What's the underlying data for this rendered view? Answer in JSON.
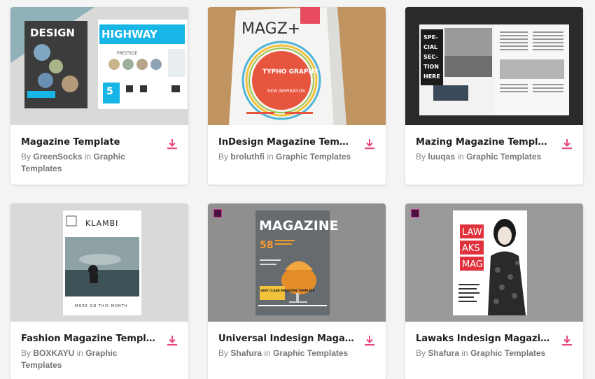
{
  "cards": [
    {
      "title": "Magazine Template",
      "by": "By",
      "author": "GreenSocks",
      "in": "in",
      "category": "Graphic Templates",
      "cover_text": [
        "DESIGN",
        "HIGHWAY",
        "PRESTIGE",
        "5"
      ]
    },
    {
      "title": "InDesign Magazine Templ...",
      "by": "By",
      "author": "broluthfi",
      "in": "in",
      "category": "Graphic Templates",
      "cover_text": [
        "MAGZ+",
        "TYPHO GRAPHY",
        "NEW INSPIRATION"
      ]
    },
    {
      "title": "Mazing Magazine Template",
      "by": "By",
      "author": "luuqas",
      "in": "in",
      "category": "Graphic Templates",
      "cover_text": [
        "SPE-",
        "CIAL",
        "SEC-",
        "TION",
        "HERE"
      ]
    },
    {
      "title": "Fashion Magazine Templa...",
      "by": "By",
      "author": "BOXKAYU",
      "in": "in",
      "category": "Graphic Templates",
      "cover_text": [
        "KLAMBI",
        "MORE ON THIS MONTH"
      ]
    },
    {
      "title": "Universal Indesign Magaz...",
      "by": "By",
      "author": "Shafura",
      "in": "in",
      "category": "Graphic Templates",
      "cover_text": [
        "MAGAZINE",
        "58",
        "VERY CLEAN MAGAZINE TEMPLATE"
      ]
    },
    {
      "title": "Lawaks Indesign Magazin...",
      "by": "By",
      "author": "Shafura",
      "in": "in",
      "category": "Graphic Templates",
      "cover_text": [
        "LAW",
        "AKS",
        "MAG"
      ]
    }
  ],
  "icons": {
    "download": "download-icon",
    "indesign_badge": "indesign-icon"
  },
  "colors": {
    "accent": "#e8467c",
    "title": "#1e1e1e",
    "meta": "#8a8a8a"
  }
}
